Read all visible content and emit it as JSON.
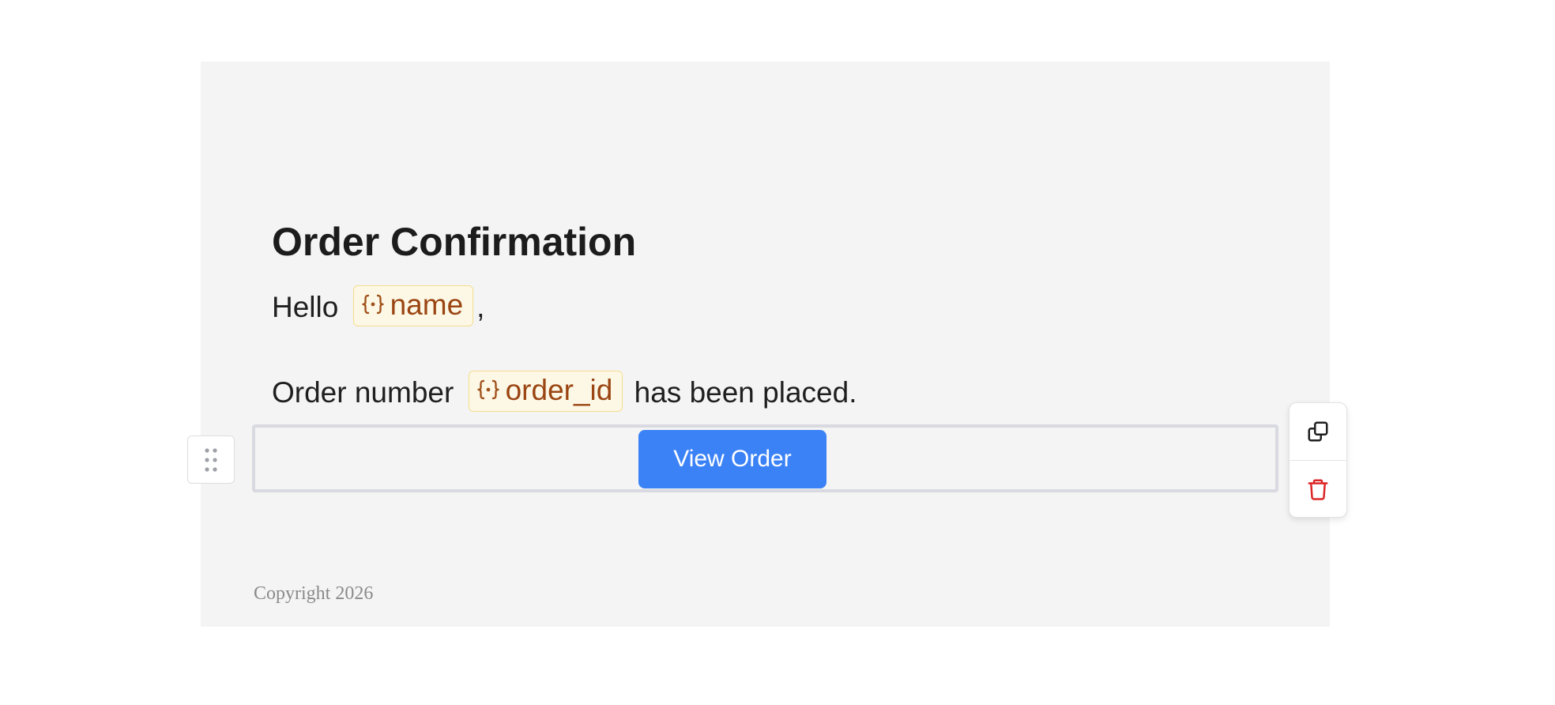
{
  "email": {
    "heading": "Order Confirmation",
    "greeting": {
      "prefix": "Hello",
      "variable": "name",
      "suffix": ","
    },
    "order_line": {
      "prefix": "Order number",
      "variable": "order_id",
      "suffix": "has been placed."
    },
    "button": {
      "label": "View Order",
      "color": "#3b82f6"
    },
    "footer": "Copyright 2026"
  },
  "editor": {
    "drag_handle_icon": "grip-vertical-icon",
    "toolbar": {
      "duplicate_icon": "copy-icon",
      "delete_icon": "trash-icon",
      "delete_color": "#dc2626"
    },
    "variable_icon": "variable-braces-icon",
    "variable_chip_colors": {
      "background": "#fdf8e6",
      "border": "#f4dd8d",
      "text": "#9a4512"
    }
  }
}
